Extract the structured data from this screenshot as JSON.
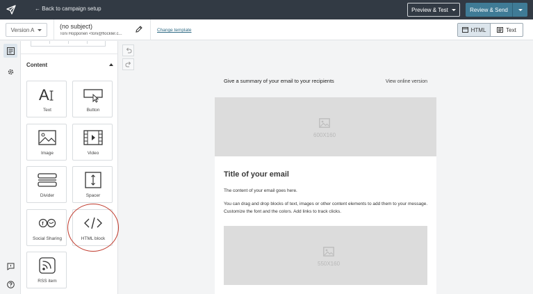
{
  "topbar": {
    "logo_icon": "send-arrow-icon",
    "back_label": "← Back to campaign setup",
    "preview_label": "Preview & Test",
    "review_label": "Review & Send"
  },
  "subbar": {
    "version_label": "Version A",
    "subject": "(no subject)",
    "sender": "Toni Hopponen <toni@flockler.c...",
    "change_template": "Change template",
    "html_label": "HTML",
    "text_label": "Text"
  },
  "panel": {
    "section_title": "Content",
    "tiles": [
      {
        "label": "Text",
        "icon": "text-icon"
      },
      {
        "label": "Button",
        "icon": "button-icon"
      },
      {
        "label": "Image",
        "icon": "image-icon"
      },
      {
        "label": "Video",
        "icon": "video-icon"
      },
      {
        "label": "Divider",
        "icon": "divider-icon"
      },
      {
        "label": "Spacer",
        "icon": "spacer-icon"
      },
      {
        "label": "Social Sharing",
        "icon": "social-sharing-icon"
      },
      {
        "label": "HTML block",
        "icon": "code-icon"
      },
      {
        "label": "RSS item",
        "icon": "rss-icon"
      }
    ]
  },
  "email": {
    "preheader": "Give a summary of your email to your recipients",
    "view_online": "View online version",
    "hero_size": "600X160",
    "title": "Title of your email",
    "paragraph1": "The content of your email goes here.",
    "paragraph2": "You can drag and drop blocks of text, images or other content elements to add them to your message. Customize the font and the colors. Add links to track clicks.",
    "image2_size": "550X160"
  },
  "colors": {
    "topbar": "#323a44",
    "review_button": "#3f7b96",
    "highlight_circle": "#c0392b"
  }
}
